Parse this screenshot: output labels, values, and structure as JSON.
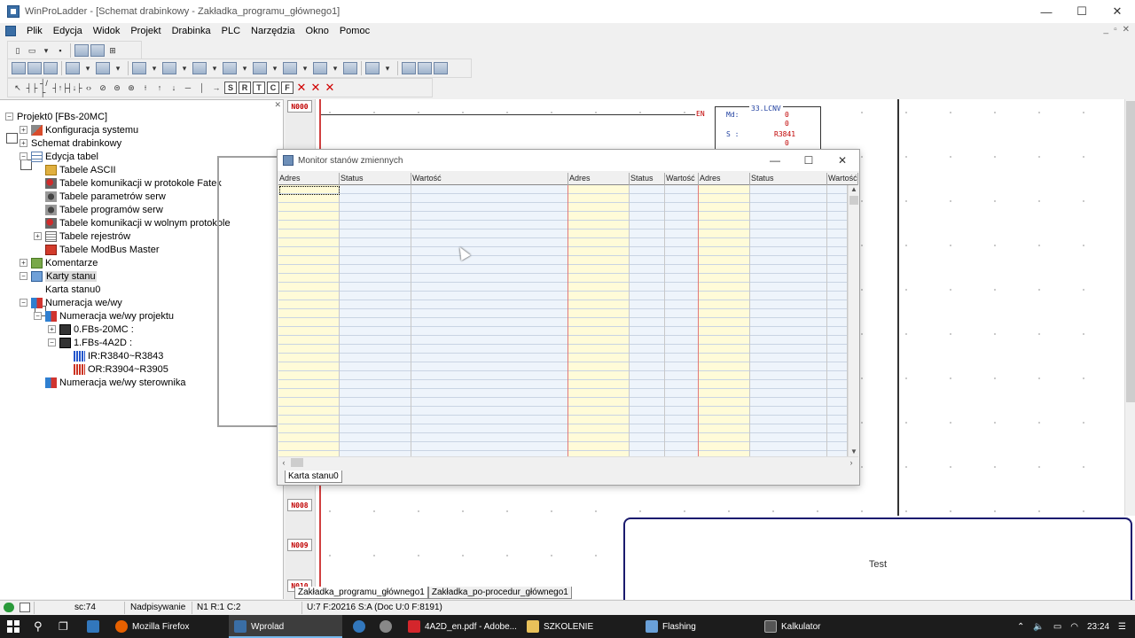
{
  "window": {
    "title": "WinProLadder - [Schemat drabinkowy - Zakładka_programu_głównego1]",
    "controls": [
      "—",
      "☐",
      "✕"
    ]
  },
  "menu": {
    "items": [
      "Plik",
      "Edycja",
      "Widok",
      "Projekt",
      "Drabinka",
      "PLC",
      "Narzędzia",
      "Okno",
      "Pomoc"
    ],
    "mdi_controls": [
      "_",
      "▫",
      "✕"
    ]
  },
  "tree": {
    "items": [
      {
        "label": "Projekt0 [FBs-20MC]",
        "icon": "project-icon"
      },
      {
        "label": "Konfiguracja systemu",
        "icon": "tools-icon"
      },
      {
        "label": "Schemat drabinkowy",
        "icon": "ladder-icon"
      },
      {
        "label": "Edycja tabel",
        "icon": "table-edit-icon"
      },
      {
        "label": "Tabele ASCII",
        "icon": "ascii-icon"
      },
      {
        "label": "Tabele komunikacji w protokole Fatek",
        "icon": "comm-icon"
      },
      {
        "label": "Tabele parametrów serw",
        "icon": "servo-param-icon"
      },
      {
        "label": "Tabele programów serw",
        "icon": "servo-prog-icon"
      },
      {
        "label": "Tabele komunikacji w wolnym protokole",
        "icon": "comm-free-icon"
      },
      {
        "label": "Tabele rejestrów",
        "icon": "register-icon"
      },
      {
        "label": "Tabele ModBus Master",
        "icon": "modbus-icon"
      },
      {
        "label": "Komentarze",
        "icon": "comment-icon"
      },
      {
        "label": "Karty stanu",
        "icon": "status-card-icon"
      },
      {
        "label": "Karta stanu0",
        "icon": "card-icon"
      },
      {
        "label": "Numeracja we/wy",
        "icon": "io-icon"
      },
      {
        "label": "Numeracja we/wy projektu",
        "icon": "io-project-icon"
      },
      {
        "label": "0.FBs-20MC :",
        "icon": "plc-icon"
      },
      {
        "label": "1.FBs-4A2D :",
        "icon": "plc-module-icon"
      },
      {
        "label": "IR:R3840~R3843",
        "icon": "ir-icon"
      },
      {
        "label": "OR:R3904~R3905",
        "icon": "or-icon"
      },
      {
        "label": "Numeracja we/wy sterownika",
        "icon": "io-plc-icon"
      }
    ]
  },
  "ladder": {
    "rungs": [
      "N000",
      "N008",
      "N009",
      "N010"
    ],
    "en_label": "EN",
    "function_block": {
      "title": "33.LCNV",
      "md_label": "Md:",
      "md_value1": "0",
      "md_value2": "0",
      "s_label": "S :",
      "s_value1": "R3841",
      "s_value2": "0"
    },
    "tabs": [
      "Zakładka_programu_głównego1",
      "Zakładka_po-procedur_głównego1"
    ]
  },
  "monitor": {
    "title": "Monitor stanów zmiennych",
    "controls": [
      "—",
      "☐",
      "✕"
    ],
    "columns": [
      "Adres",
      "Status",
      "Wartość",
      "Adres",
      "Status",
      "Wartość",
      "Adres",
      "Status",
      "Wartość"
    ],
    "tab": "Karta stanu0"
  },
  "popup": {
    "text": "Test"
  },
  "statusbar": {
    "sc": "sc:74",
    "mode": "Nadpisywanie",
    "pos": "N1 R:1 C:2",
    "mem": "U:7 F:20216 S:A (Doc U:0 F:8191)"
  },
  "taskbar": {
    "apps": [
      {
        "label": "Mozilla Firefox",
        "color": "#e66000"
      },
      {
        "label": "Wprolad",
        "color": "#3a6ea5"
      },
      {
        "label": "",
        "color": "#3277bc"
      },
      {
        "label": "",
        "color": "#888888"
      },
      {
        "label": "4A2D_en.pdf - Adobe...",
        "color": "#d4262c"
      },
      {
        "label": "SZKOLENIE",
        "color": "#e8c15a"
      },
      {
        "label": "Flashing",
        "color": "#6aa0d8"
      },
      {
        "label": "Kalkulator",
        "color": "#555555"
      }
    ],
    "clock": "23:24"
  }
}
